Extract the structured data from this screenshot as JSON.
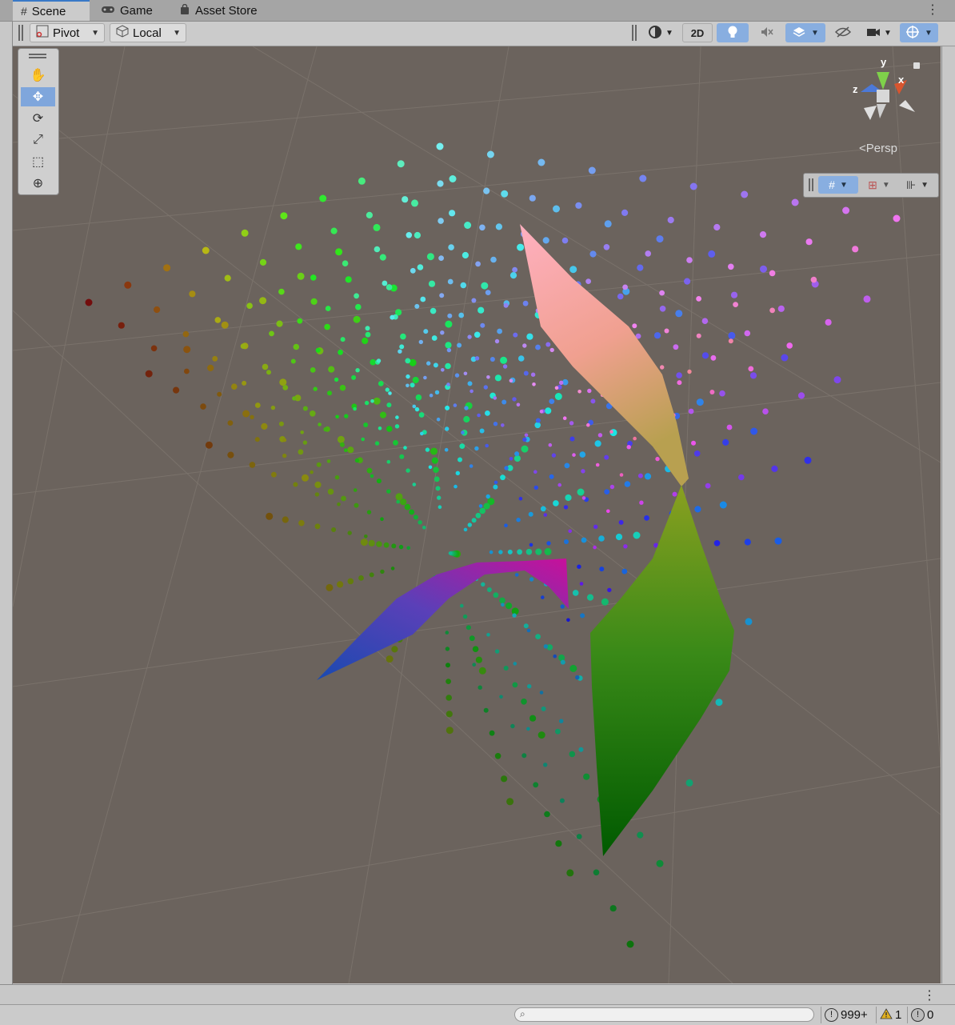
{
  "tabs": [
    {
      "label": "Scene",
      "icon": "hash-icon"
    },
    {
      "label": "Game",
      "icon": "gamepad-icon"
    },
    {
      "label": "Asset Store",
      "icon": "shopping-bag-icon"
    }
  ],
  "toolbar": {
    "pivot_label": "Pivot",
    "local_label": "Local",
    "mode_2d_label": "2D"
  },
  "scene_view": {
    "projection_label": "Persp",
    "gizmo_axes": {
      "x": "x",
      "y": "y",
      "z": "z"
    },
    "background_color": "#6b635d"
  },
  "tools": [
    "hand-tool",
    "move-tool",
    "rotate-tool",
    "scale-tool",
    "rect-tool",
    "transform-tool"
  ],
  "status": {
    "search_placeholder": "",
    "log_count": "999+",
    "warning_count": "1",
    "error_count": "0"
  },
  "colors": {
    "accent": "#3a79c7",
    "selected_tool": "#7fa6dc"
  }
}
